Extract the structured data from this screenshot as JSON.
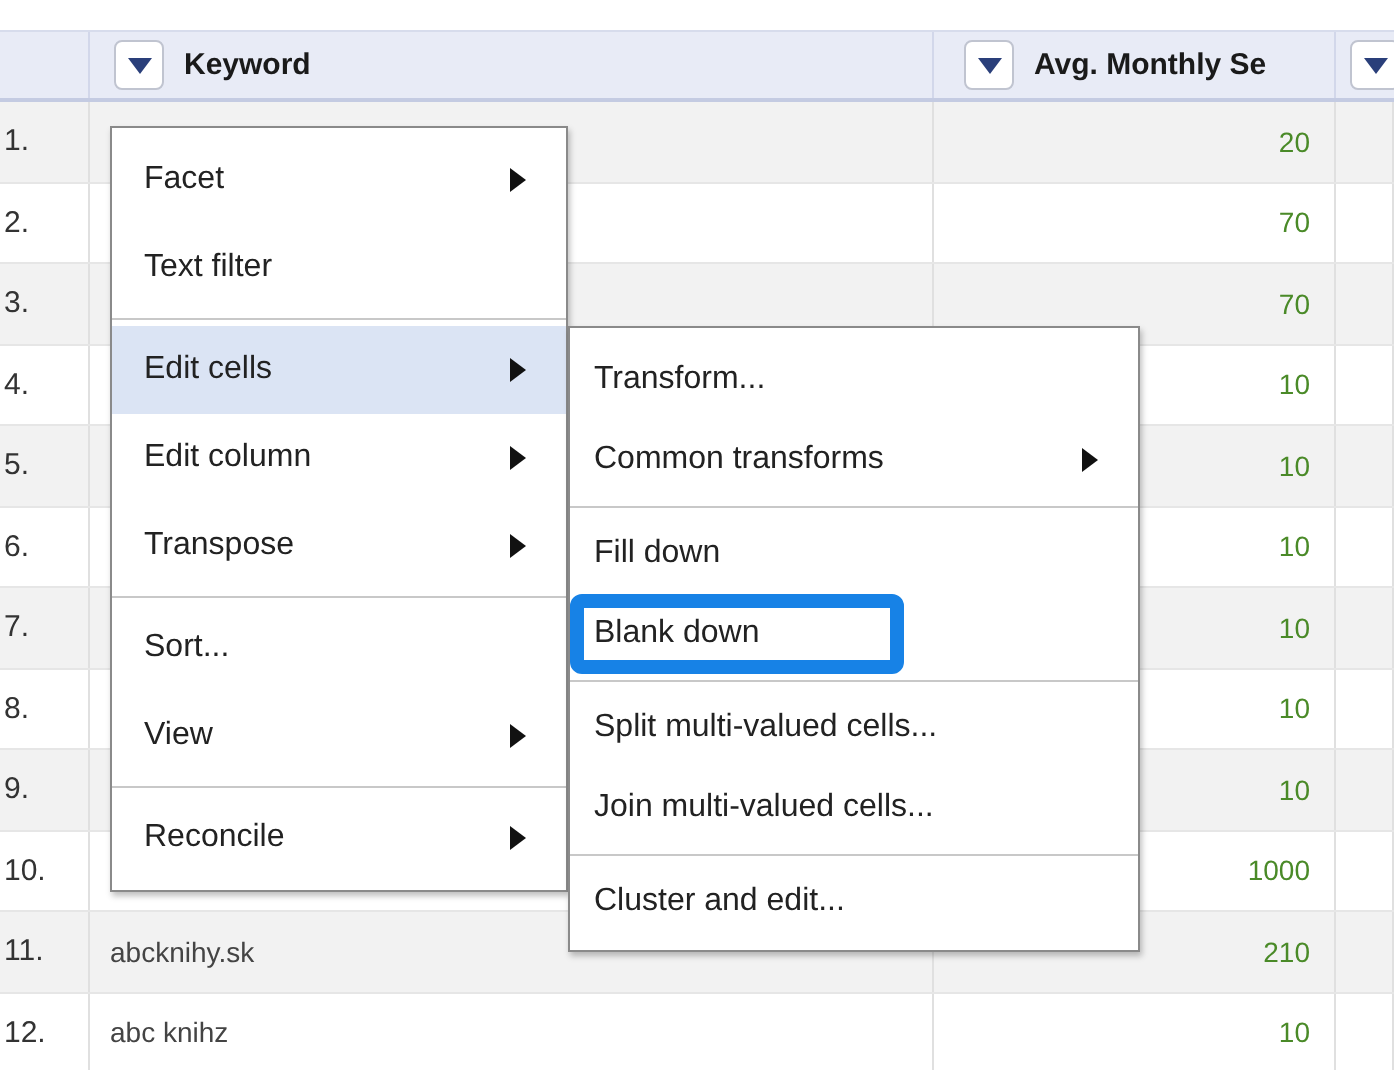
{
  "table": {
    "columns": [
      {
        "label": "Keyword"
      },
      {
        "label": "Avg. Monthly Se"
      },
      {}
    ],
    "rows": [
      {
        "index": "1.",
        "value": "20"
      },
      {
        "index": "2.",
        "value": "70"
      },
      {
        "index": "3.",
        "value": "70"
      },
      {
        "index": "4.",
        "value": "10"
      },
      {
        "index": "5.",
        "value": "10"
      },
      {
        "index": "6.",
        "value": "10"
      },
      {
        "index": "7.",
        "value": "10"
      },
      {
        "index": "8.",
        "value": "10"
      },
      {
        "index": "9.",
        "value": "10"
      },
      {
        "index": "10.",
        "value": "1000"
      },
      {
        "index": "11.",
        "keyword": "abcknihy.sk",
        "value": "210"
      },
      {
        "index": "12.",
        "keyword": "abc knihz",
        "value": "10"
      }
    ]
  },
  "column_menu": {
    "groups": [
      [
        {
          "label": "Facet",
          "submenu": true,
          "selected": false
        },
        {
          "label": "Text filter",
          "submenu": false,
          "selected": false
        }
      ],
      [
        {
          "label": "Edit cells",
          "submenu": true,
          "selected": true
        },
        {
          "label": "Edit column",
          "submenu": true,
          "selected": false
        },
        {
          "label": "Transpose",
          "submenu": true,
          "selected": false
        }
      ],
      [
        {
          "label": "Sort...",
          "submenu": false,
          "selected": false
        },
        {
          "label": "View",
          "submenu": true,
          "selected": false
        }
      ],
      [
        {
          "label": "Reconcile",
          "submenu": true,
          "selected": false
        }
      ]
    ]
  },
  "edit_cells_menu": {
    "groups": [
      [
        {
          "label": "Transform...",
          "submenu": false,
          "highlighted": false
        },
        {
          "label": "Common transforms",
          "submenu": true,
          "highlighted": false
        }
      ],
      [
        {
          "label": "Fill down",
          "submenu": false,
          "highlighted": false
        },
        {
          "label": "Blank down",
          "submenu": false,
          "highlighted": true
        }
      ],
      [
        {
          "label": "Split multi-valued cells...",
          "submenu": false,
          "highlighted": false
        },
        {
          "label": "Join multi-valued cells...",
          "submenu": false,
          "highlighted": false
        }
      ],
      [
        {
          "label": "Cluster and edit...",
          "submenu": false,
          "highlighted": false
        }
      ]
    ]
  }
}
